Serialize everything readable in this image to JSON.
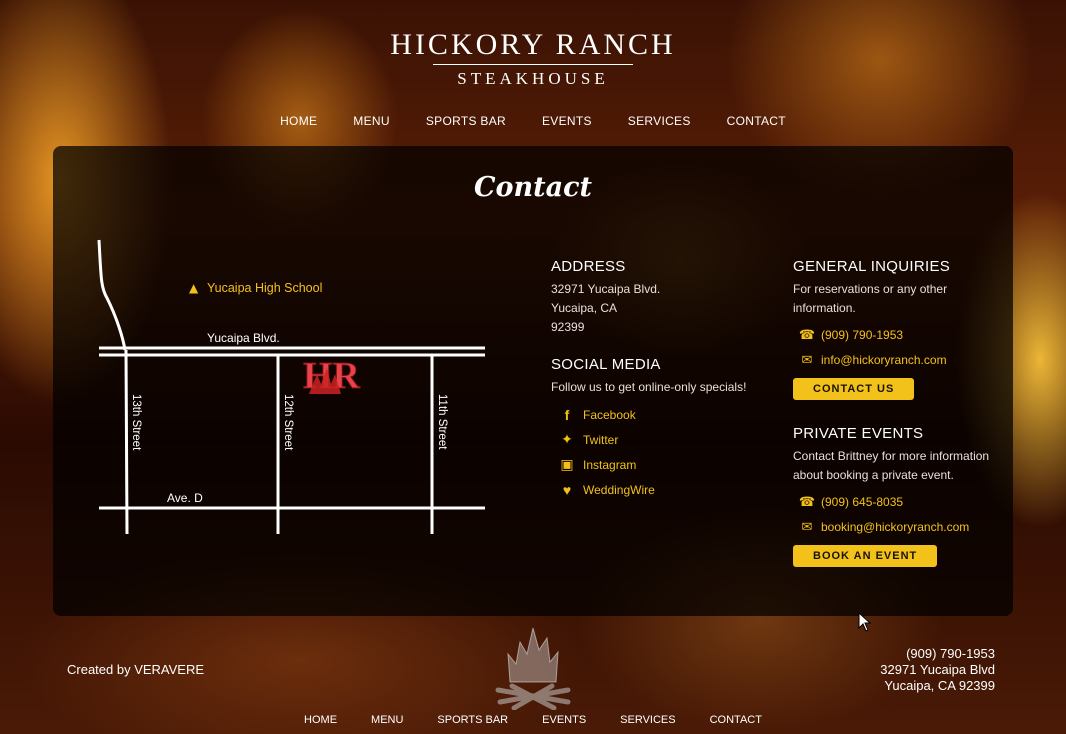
{
  "header": {
    "logo_main": "HICKORY RANCH",
    "logo_sub": "STEAKHOUSE"
  },
  "nav": [
    "HOME",
    "MENU",
    "SPORTS BAR",
    "EVENTS",
    "SERVICES",
    "CONTACT"
  ],
  "page_title": "Contact",
  "map": {
    "school": "Yucaipa High School",
    "street_top": "Yucaipa Blvd.",
    "street_bottom": "Ave. D",
    "street_13": "13th Street",
    "street_12": "12th Street",
    "street_11": "11th Street",
    "marker_text": "HR"
  },
  "address": {
    "heading": "ADDRESS",
    "line1": "32971 Yucaipa Blvd.",
    "line2": "Yucaipa, CA",
    "line3": "92399"
  },
  "social": {
    "heading": "SOCIAL MEDIA",
    "subtitle": "Follow us to get online-only specials!",
    "items": [
      {
        "icon": "facebook-icon",
        "label": "Facebook"
      },
      {
        "icon": "twitter-icon",
        "label": "Twitter"
      },
      {
        "icon": "instagram-icon",
        "label": "Instagram"
      },
      {
        "icon": "heart-icon",
        "label": "WeddingWire"
      }
    ]
  },
  "general": {
    "heading": "GENERAL INQUIRIES",
    "text": "For reservations or any other information.",
    "phone": "(909) 790-1953",
    "email": "info@hickoryranch.com",
    "button": "CONTACT US"
  },
  "private": {
    "heading": "PRIVATE EVENTS",
    "text": "Contact Brittney for more information about booking a private event.",
    "phone": "(909) 645-8035",
    "email": "booking@hickoryranch.com",
    "button": "BOOK AN EVENT"
  },
  "footer": {
    "credit": "Created by VERAVERE",
    "phone": "(909) 790-1953",
    "address1": "32971 Yucaipa Blvd",
    "address2": "Yucaipa, CA 92399",
    "nav": [
      "HOME",
      "MENU",
      "SPORTS BAR",
      "EVENTS",
      "SERVICES",
      "CONTACT"
    ]
  },
  "colors": {
    "accent": "#f2c21b",
    "marker": "#e8434a"
  }
}
